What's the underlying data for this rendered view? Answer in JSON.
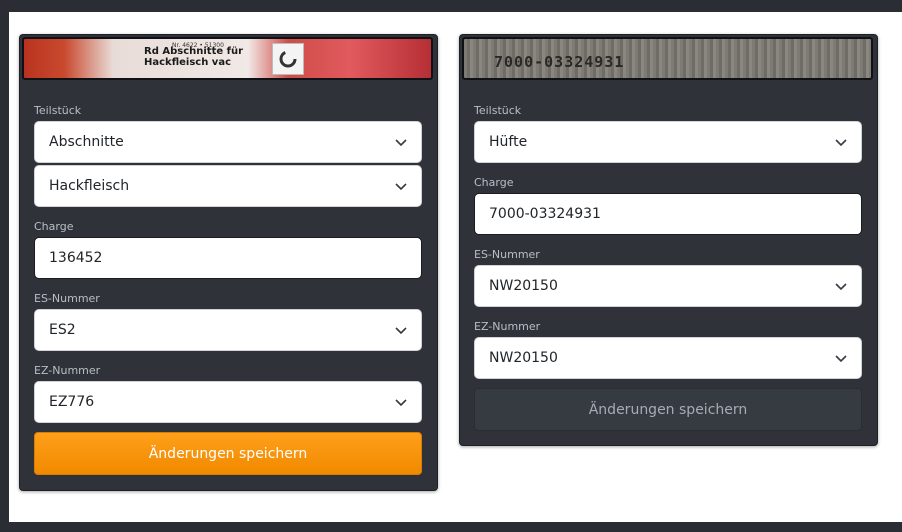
{
  "colors": {
    "primary": "#f7931a",
    "card": "#2f3339",
    "page": "#ffffff"
  },
  "cards": [
    {
      "image_text": {
        "small": "Nr. 4622 • 51300",
        "line1": "Rd Abschnitte für",
        "line2": "Hackfleisch vac"
      },
      "teilstueck_label": "Teilstück",
      "teilstueck": "Abschnitte",
      "teilstueck_2": "Hackfleisch",
      "charge_label": "Charge",
      "charge": "136452",
      "es_label": "ES-Nummer",
      "es": "ES2",
      "ez_label": "EZ-Nummer",
      "ez": "EZ776",
      "save_label": "Änderungen speichern"
    },
    {
      "image_text": {
        "code": "7000-03324931"
      },
      "teilstueck_label": "Teilstück",
      "teilstueck": "Hüfte",
      "charge_label": "Charge",
      "charge": "7000-03324931",
      "es_label": "ES-Nummer",
      "es": "NW20150",
      "ez_label": "EZ-Nummer",
      "ez": "NW20150",
      "save_label": "Änderungen speichern"
    }
  ]
}
